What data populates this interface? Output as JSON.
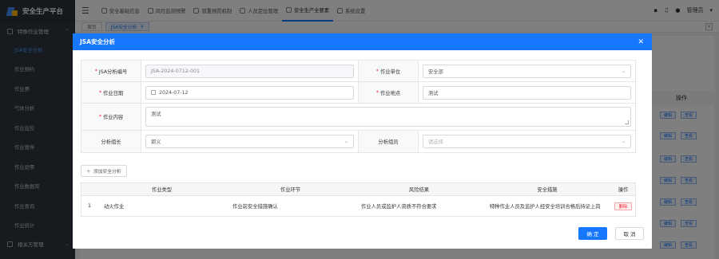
{
  "app": {
    "title": "安全生产平台"
  },
  "sidebar": {
    "group1": "特殊作业管理",
    "items": [
      "JSA安全分析",
      "作业预约",
      "作业票",
      "气体分析",
      "作业监控",
      "作业暂停",
      "作业验票",
      "作业数据库",
      "作业查询",
      "作业统计"
    ],
    "group2": "相关方管理"
  },
  "topnav": {
    "items": [
      "安全基础信息",
      "风险监测预警",
      "双重预防机制",
      "人员定位管理",
      "安全生产全要素",
      "系统设置"
    ],
    "user": "管理员"
  },
  "tabs": {
    "home": "首页",
    "current": "JSA安全分析"
  },
  "background": {
    "ops_header": "操作",
    "edit": "编辑",
    "view": "查看"
  },
  "dialog": {
    "title": "JSA安全分析",
    "labels": {
      "jsa_no": "JSA分析编号",
      "unit": "作业单位",
      "date": "作业日期",
      "location": "作业地点",
      "content": "作业内容",
      "leader": "分析组长",
      "members": "分析组员"
    },
    "values": {
      "jsa_no": "JSA-2024-0712-001",
      "unit": "安全部",
      "date": "2024-07-12",
      "location": "测试",
      "content": "测试",
      "leader": "郭义",
      "members_placeholder": "请选择"
    },
    "add_button": "添加安全分析",
    "table": {
      "headers": [
        "作业类型",
        "作业环节",
        "风险结果",
        "安全措施",
        "操作"
      ],
      "rows": [
        {
          "idx": "1",
          "type": "动火作业",
          "step": "作业前安全措施确认",
          "risk": "作业人员或监护人资质不符合要求",
          "measure": "特种作业人员及监护人经安全培训合格后持证上岗",
          "action": "删除"
        }
      ]
    },
    "confirm": "确 定",
    "cancel": "取 消"
  }
}
